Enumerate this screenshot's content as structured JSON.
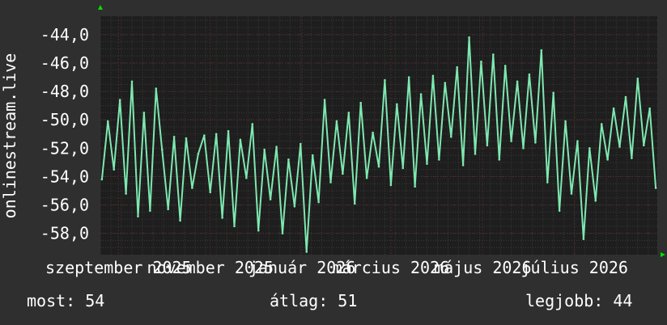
{
  "chart_data": {
    "type": "line",
    "ylabel": "onlinestream.live",
    "ylim": [
      -59.5,
      -42.7
    ],
    "yticks": [
      -44,
      -46,
      -48,
      -50,
      -52,
      -54,
      -56,
      -58
    ],
    "ytick_labels": [
      "-44,0",
      "-46,0",
      "-48,0",
      "-50,0",
      "-52,0",
      "-54,0",
      "-56,0",
      "-58,0"
    ],
    "x_start": "2025-08-20",
    "x_end": "2026-08-25",
    "xticks": [
      {
        "label": "szeptember 2025",
        "date": "2025-09-01"
      },
      {
        "label": "november 2025",
        "date": "2025-11-01"
      },
      {
        "label": "január 2026",
        "date": "2026-01-01"
      },
      {
        "label": "március 2026",
        "date": "2026-03-01"
      },
      {
        "label": "május 2026",
        "date": "2026-05-01"
      },
      {
        "label": "július 2026",
        "date": "2026-07-01"
      }
    ],
    "grid": true,
    "line_color": "#7ee8b0",
    "series": [
      {
        "x": [
          "2025-08-21",
          "2025-08-25",
          "2025-08-29",
          "2025-09-02",
          "2025-09-06",
          "2025-09-10",
          "2025-09-14",
          "2025-09-18",
          "2025-09-22",
          "2025-09-26",
          "2025-09-30",
          "2025-10-04",
          "2025-10-08",
          "2025-10-12",
          "2025-10-16",
          "2025-10-20",
          "2025-10-24",
          "2025-10-28",
          "2025-11-01",
          "2025-11-05",
          "2025-11-09",
          "2025-11-13",
          "2025-11-17",
          "2025-11-21",
          "2025-11-25",
          "2025-11-29",
          "2025-12-03",
          "2025-12-07",
          "2025-12-11",
          "2025-12-15",
          "2025-12-19",
          "2025-12-23",
          "2025-12-27",
          "2025-12-31",
          "2026-01-04",
          "2026-01-08",
          "2026-01-12",
          "2026-01-16",
          "2026-01-20",
          "2026-01-24",
          "2026-01-28",
          "2026-02-01",
          "2026-02-05",
          "2026-02-09",
          "2026-02-13",
          "2026-02-17",
          "2026-02-21",
          "2026-02-25",
          "2026-03-01",
          "2026-03-05",
          "2026-03-09",
          "2026-03-13",
          "2026-03-17",
          "2026-03-21",
          "2026-03-25",
          "2026-03-29",
          "2026-04-02",
          "2026-04-06",
          "2026-04-10",
          "2026-04-14",
          "2026-04-18",
          "2026-04-22",
          "2026-04-26",
          "2026-04-30",
          "2026-05-04",
          "2026-05-08",
          "2026-05-12",
          "2026-05-16",
          "2026-05-20",
          "2026-05-24",
          "2026-05-28",
          "2026-06-01",
          "2026-06-05",
          "2026-06-09",
          "2026-06-13",
          "2026-06-17",
          "2026-06-21",
          "2026-06-25",
          "2026-06-29",
          "2026-07-03",
          "2026-07-07",
          "2026-07-11",
          "2026-07-15",
          "2026-07-19",
          "2026-07-23",
          "2026-07-27",
          "2026-07-31",
          "2026-08-04",
          "2026-08-08",
          "2026-08-12",
          "2026-08-16",
          "2026-08-20",
          "2026-08-24"
        ],
        "values": [
          -54.2,
          -50.1,
          -53.5,
          -48.6,
          -55.2,
          -47.3,
          -56.8,
          -49.5,
          -56.4,
          -47.8,
          -52.1,
          -56.3,
          -51.2,
          -57.1,
          -51.3,
          -54.8,
          -52.4,
          -51.1,
          -55.1,
          -51.0,
          -56.9,
          -50.8,
          -57.5,
          -51.4,
          -54.1,
          -50.3,
          -57.8,
          -52.1,
          -55.6,
          -51.9,
          -58.0,
          -52.8,
          -56.1,
          -51.7,
          -59.3,
          -52.5,
          -55.8,
          -48.6,
          -54.4,
          -50.1,
          -53.8,
          -49.5,
          -55.9,
          -48.8,
          -54.1,
          -50.9,
          -53.3,
          -47.2,
          -54.6,
          -48.9,
          -53.4,
          -47.0,
          -54.7,
          -48.2,
          -53.1,
          -46.9,
          -52.8,
          -47.4,
          -51.2,
          -46.3,
          -53.2,
          -44.2,
          -52.4,
          -45.9,
          -51.8,
          -45.4,
          -52.8,
          -46.2,
          -51.5,
          -47.3,
          -52.0,
          -46.8,
          -51.6,
          -45.1,
          -54.4,
          -48.1,
          -56.4,
          -50.1,
          -55.2,
          -51.5,
          -58.4,
          -52.0,
          -55.7,
          -50.3,
          -52.8,
          -49.2,
          -51.9,
          -48.4,
          -52.7,
          -47.1,
          -51.8,
          -49.2,
          -54.8
        ]
      }
    ]
  },
  "stats": {
    "current_label": "most:",
    "current_value": "54",
    "average_label": "átlag:",
    "average_value": "51",
    "best_label": "legjobb:",
    "best_value": "44"
  },
  "colors": {
    "background": "#2f2f2f",
    "plot_background": "#1e1e1e",
    "grid_minor": "#3a3a3a",
    "grid_major": "#4a2a2a",
    "arrow": "#00e000"
  }
}
